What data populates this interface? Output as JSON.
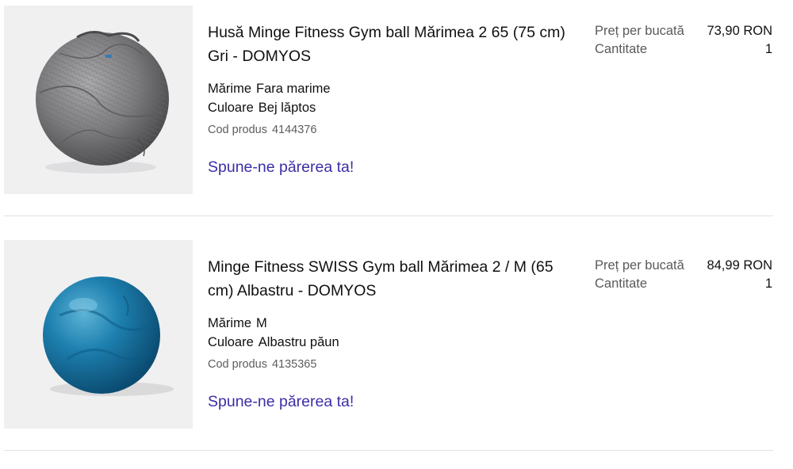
{
  "items": [
    {
      "title_line1": "Husă Minge Fitness Gym ball Mărimea 2 65 (75 cm)",
      "title_line2": "Gri - DOMYOS",
      "size_label": "Mărime",
      "size_value": "Fara marime",
      "color_label": "Culoare",
      "color_value": "Bej lăptos",
      "code_label": "Cod produs",
      "code_value": "4144376",
      "review_link": "Spune-ne părerea ta!",
      "price_label": "Preț per bucată",
      "price_value": "73,90 RON",
      "qty_label": "Cantitate",
      "qty_value": "1",
      "image_icon": "grey-ball-cover-image"
    },
    {
      "title_line1": "Minge Fitness SWISS Gym ball Mărimea 2 / M (65",
      "title_line2": "cm) Albastru - DOMYOS",
      "size_label": "Mărime",
      "size_value": "M",
      "color_label": "Culoare",
      "color_value": "Albastru păun",
      "code_label": "Cod produs",
      "code_value": "4135365",
      "review_link": "Spune-ne părerea ta!",
      "price_label": "Preț per bucată",
      "price_value": "84,99 RON",
      "qty_label": "Cantitate",
      "qty_value": "1",
      "image_icon": "blue-fitness-ball-image"
    }
  ],
  "colors": {
    "link": "#3b2ea6",
    "muted_text": "#5a5a5a",
    "divider": "#e3e3e6",
    "thumb_bg": "#f0f0f1"
  }
}
